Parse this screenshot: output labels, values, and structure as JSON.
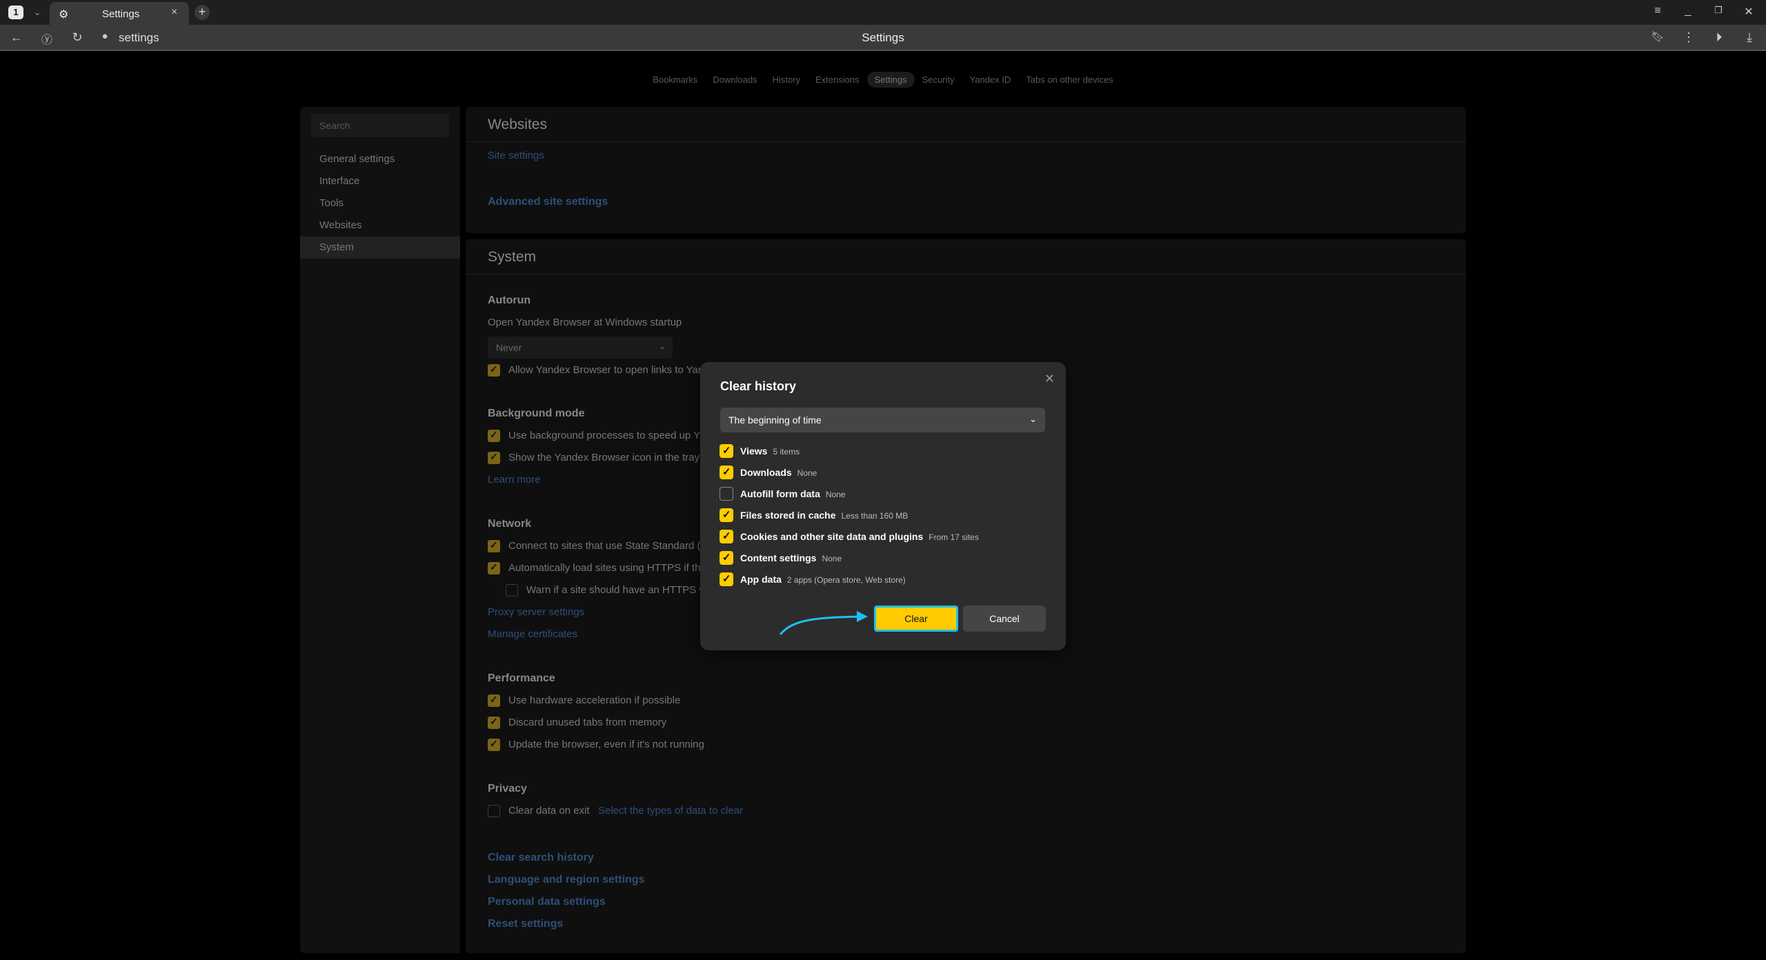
{
  "browser": {
    "tab_count": "1",
    "tab_title": "Settings",
    "url": "settings",
    "page_title": "Settings"
  },
  "topnav": [
    "Bookmarks",
    "Downloads",
    "History",
    "Extensions",
    "Settings",
    "Security",
    "Yandex ID",
    "Tabs on other devices"
  ],
  "sidebar": {
    "search_placeholder": "Search",
    "items": [
      "General settings",
      "Interface",
      "Tools",
      "Websites",
      "System"
    ]
  },
  "websites": {
    "title": "Websites",
    "site_settings": "Site settings",
    "advanced": "Advanced site settings"
  },
  "system": {
    "title": "System",
    "autorun": {
      "heading": "Autorun",
      "label": "Open Yandex Browser at Windows startup",
      "select_value": "Never",
      "allow_links": "Allow Yandex Browser to open links to Yan"
    },
    "background": {
      "heading": "Background mode",
      "item1": "Use background processes to speed up Ya",
      "item2": "Show the Yandex Browser icon in the tray",
      "learn_more": "Learn more"
    },
    "network": {
      "heading": "Network",
      "item1": "Connect to sites that use State Standard (",
      "item2": "Automatically load sites using HTTPS if th",
      "item3": "Warn if a site should have an HTTPS ve",
      "proxy": "Proxy server settings",
      "certs": "Manage certificates"
    },
    "performance": {
      "heading": "Performance",
      "item1": "Use hardware acceleration if possible",
      "item2": "Discard unused tabs from memory",
      "item3": "Update the browser, even if it's not running"
    },
    "privacy": {
      "heading": "Privacy",
      "clear_on_exit": "Clear data on exit",
      "select_types": "Select the types of data to clear"
    },
    "links": [
      "Clear search history",
      "Language and region settings",
      "Personal data settings",
      "Reset settings"
    ]
  },
  "modal": {
    "title": "Clear history",
    "period": "The beginning of time",
    "items": [
      {
        "label": "Views",
        "desc": "5 items",
        "checked": true
      },
      {
        "label": "Downloads",
        "desc": "None",
        "checked": true
      },
      {
        "label": "Autofill form data",
        "desc": "None",
        "checked": false
      },
      {
        "label": "Files stored in cache",
        "desc": "Less than 160 MB",
        "checked": true
      },
      {
        "label": "Cookies and other site data and plugins",
        "desc": "From 17 sites",
        "checked": true
      },
      {
        "label": "Content settings",
        "desc": "None",
        "checked": true
      },
      {
        "label": "App data",
        "desc": "2 apps (Opera store, Web store)",
        "checked": true
      }
    ],
    "clear_label": "Clear",
    "cancel_label": "Cancel"
  },
  "colors": {
    "accent_yellow": "#ffcc00",
    "highlight_blue": "#1ec0f0",
    "link_blue": "#2e4f79"
  }
}
